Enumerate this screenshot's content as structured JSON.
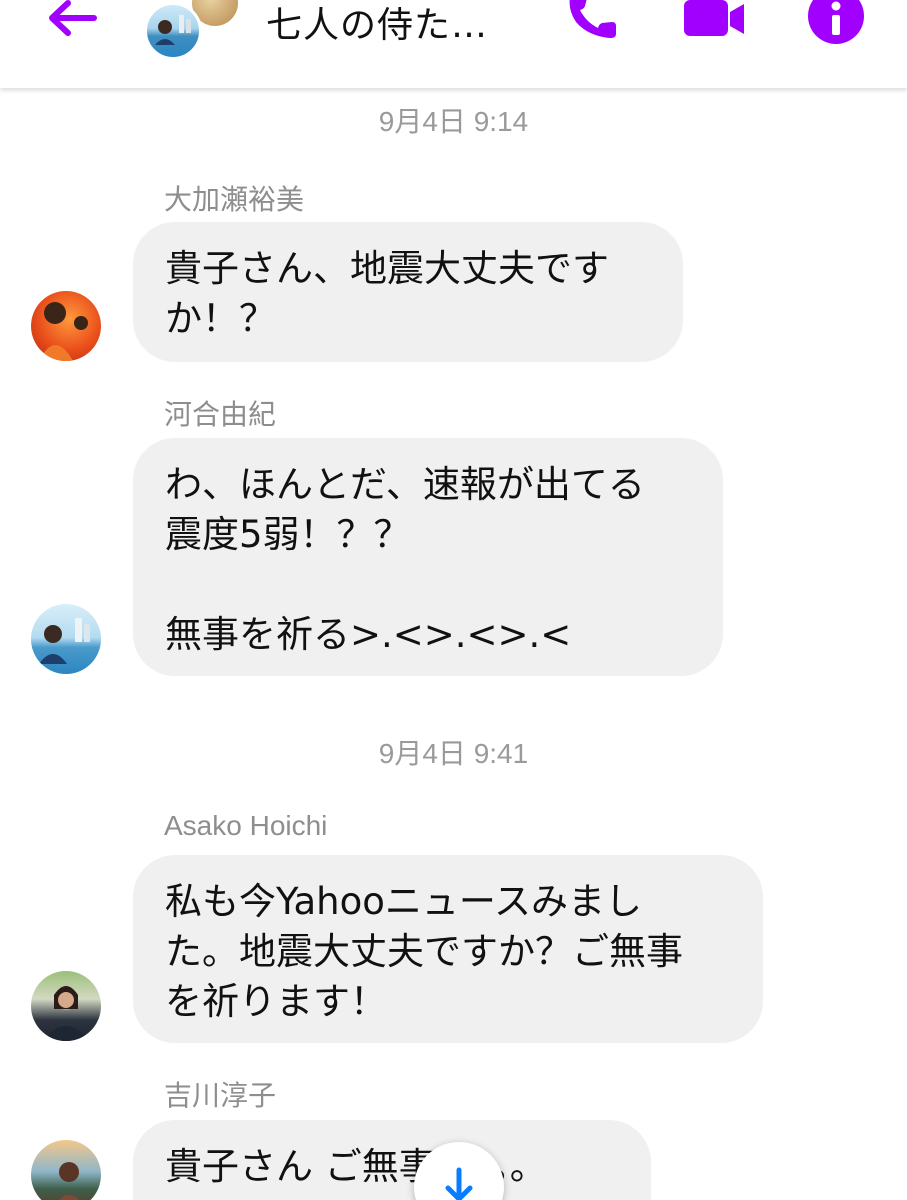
{
  "header": {
    "title": "七人の侍た…",
    "back_icon": "arrow-left-icon",
    "call_icon": "phone-icon",
    "video_icon": "video-camera-icon",
    "info_icon": "info-icon",
    "accent_color": "#a100ff"
  },
  "messages": [
    {
      "timestamp": "9月4日 9:14"
    },
    {
      "sender": "大加瀬裕美",
      "lines": [
        "貴子さん、地震大丈夫です",
        "か！？"
      ]
    },
    {
      "sender": "河合由紀",
      "lines": [
        "わ、ほんとだ、速報が出てる",
        "震度5弱！？？",
        "",
        "無事を祈る>.<>.<>.<"
      ]
    },
    {
      "timestamp": "9月4日 9:41"
    },
    {
      "sender": "Asako Hoichi",
      "lines": [
        "私も今Yahooニュースみまし",
        "た。地震大丈夫ですか？ご無事",
        "を祈ります！"
      ]
    },
    {
      "sender": "吉川淳子",
      "lines": [
        "貴子さん ご無事を。。。"
      ]
    }
  ],
  "scroll_button": {
    "icon": "arrow-down-icon",
    "color": "#0a7cff"
  },
  "colors": {
    "bubble": "#f0f0f0",
    "meta_text": "#9a9a9a"
  }
}
